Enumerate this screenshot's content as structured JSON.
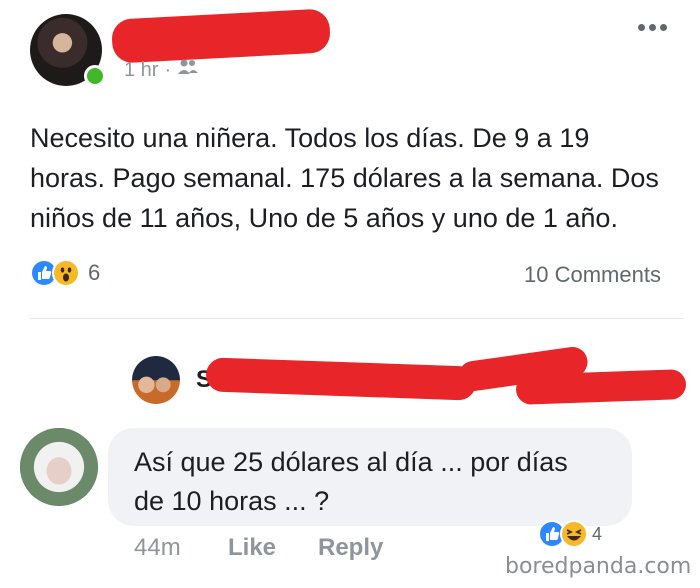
{
  "post": {
    "time": "1 hr",
    "separator": "·",
    "text": "Necesito una niñera. Todos los días. De 9 a 19\nhoras. Pago semanal. 175 dólares a la semana. Dos\nniños de 11 años, Uno de 5 años y uno de 1 año.",
    "reactions_count": "6",
    "comments_label": "10 Comments",
    "more_icon": "more-horizontal-icon",
    "audience_icon": "friends-icon"
  },
  "comment": {
    "text": "Así que 25 dólares al día ... por días\nde 10 horas ... ?",
    "time": "44m",
    "like_label": "Like",
    "reply_label": "Reply",
    "reactions_count": "4",
    "reply_author_partial": "S"
  },
  "watermark": "boredpanda.com",
  "colors": {
    "redaction": "#e8262a",
    "like_blue": "#2d88ff",
    "online_green": "#42b72a",
    "meta_gray": "#90949c"
  }
}
